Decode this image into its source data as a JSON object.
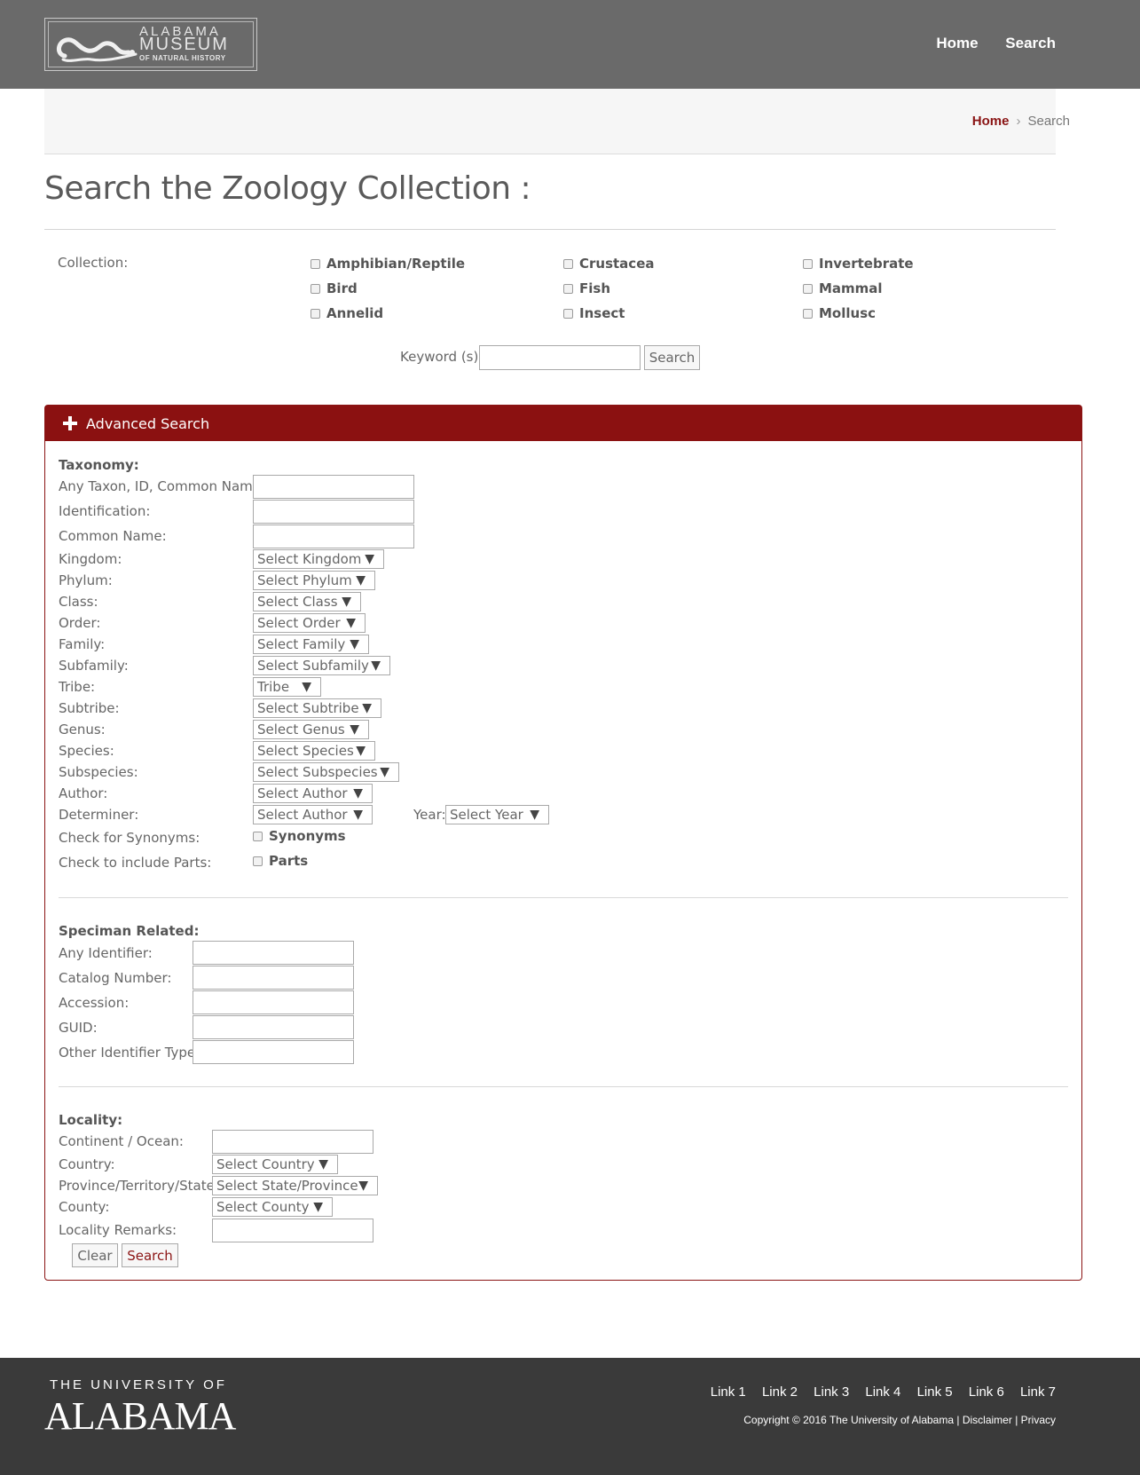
{
  "header": {
    "logo_line1": "ALABAMA",
    "logo_line2": "MUSEUM",
    "logo_line3": "OF NATURAL HISTORY",
    "nav": [
      "Home",
      "Search"
    ]
  },
  "breadcrumb": {
    "home": "Home",
    "sep": "›",
    "current": "Search"
  },
  "page_title": "Search the Zoology Collection :",
  "collection": {
    "label": "Collection:",
    "options": [
      "Amphibian/Reptile",
      "Bird",
      "Annelid",
      "Crustacea",
      "Fish",
      "Insect",
      "Invertebrate",
      "Mammal",
      "Mollusc"
    ]
  },
  "keyword": {
    "label": "Keyword (s):",
    "value": "",
    "button": "Search"
  },
  "advanced": {
    "title": "Advanced Search",
    "taxonomy": {
      "heading": "Taxonomy:",
      "text_fields": [
        "Any Taxon, ID, Common Name:",
        "Identification:",
        "Common Name:"
      ],
      "selects": [
        {
          "label": "Kingdom:",
          "value": "Select Kingdom"
        },
        {
          "label": "Phylum:",
          "value": "Select Phylum"
        },
        {
          "label": "Class:",
          "value": "Select Class"
        },
        {
          "label": "Order:",
          "value": "Select Order"
        },
        {
          "label": "Family:",
          "value": "Select Family"
        },
        {
          "label": "Subfamily:",
          "value": "Select Subfamily"
        },
        {
          "label": "Tribe:",
          "value": "Tribe"
        },
        {
          "label": "Subtribe:",
          "value": "Select Subtribe"
        },
        {
          "label": "Genus:",
          "value": "Select Genus"
        },
        {
          "label": "Species:",
          "value": "Select Species"
        },
        {
          "label": "Subspecies:",
          "value": "Select Subspecies"
        },
        {
          "label": "Author:",
          "value": "Select Author"
        },
        {
          "label": "Determiner:",
          "value": "Select Author"
        }
      ],
      "year_label": "Year:",
      "year_value": "Select Year",
      "synonyms_label": "Check for Synonyms:",
      "synonyms_check": "Synonyms",
      "parts_label": "Check to include Parts:",
      "parts_check": "Parts"
    },
    "specimen": {
      "heading": "Speciman Related:",
      "fields": [
        "Any Identifier:",
        "Catalog Number:",
        "Accession:",
        "GUID:",
        "Other Identifier Type:"
      ]
    },
    "locality": {
      "heading": "Locality:",
      "continent_label": "Continent / Ocean:",
      "country_label": "Country:",
      "country_value": "Select Country",
      "state_label": "Province/Territory/State:",
      "state_value": "Select State/Province",
      "county_label": "County:",
      "county_value": "Select County",
      "remarks_label": "Locality Remarks:"
    },
    "clear_button": "Clear",
    "search_button": "Search"
  },
  "footer": {
    "ua_line1": "THE UNIVERSITY OF",
    "ua_line2": "ALABAMA",
    "links": [
      "Link 1",
      "Link 2",
      "Link 3",
      "Link 4",
      "Link 5",
      "Link 6",
      "Link 7"
    ],
    "copyright": "Copyright © 2016 The University of Alabama",
    "disclaimer": "Disclaimer",
    "privacy": "Privacy",
    "divider": "|"
  },
  "colors": {
    "accent": "#8b1111",
    "header_bg": "#6a6a6a",
    "footer_bg": "#3a3a3a"
  }
}
